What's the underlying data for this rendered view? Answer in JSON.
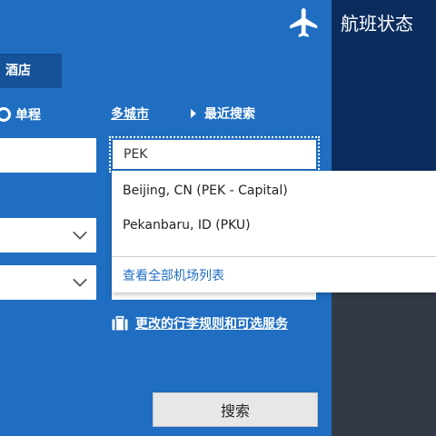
{
  "header": {
    "flight_status": "航班状态",
    "plane_icon": "airplane-icon"
  },
  "tabs": {
    "hotel_label": "酒店"
  },
  "trip_type": {
    "oneway_label": "单程",
    "multi_city_label": "多城市",
    "recent_search_label": "最近搜索"
  },
  "destination": {
    "value": "PEK"
  },
  "airport_dropdown": {
    "items": [
      {
        "label": "Beijing, CN (PEK - Capital)"
      },
      {
        "label": "Pekanbaru, ID (PKU)"
      }
    ],
    "view_all_label": "查看全部机场列表"
  },
  "baggage": {
    "link_label": "更改的行李规则和可选服务",
    "icon": "suitcase-icon"
  },
  "search": {
    "button_label": "搜索"
  },
  "colors": {
    "primary_blue": "#1f6ec2",
    "dark_navy": "#0b2d5e",
    "tab_blue": "#15529a",
    "link_blue": "#1f6ec2"
  }
}
